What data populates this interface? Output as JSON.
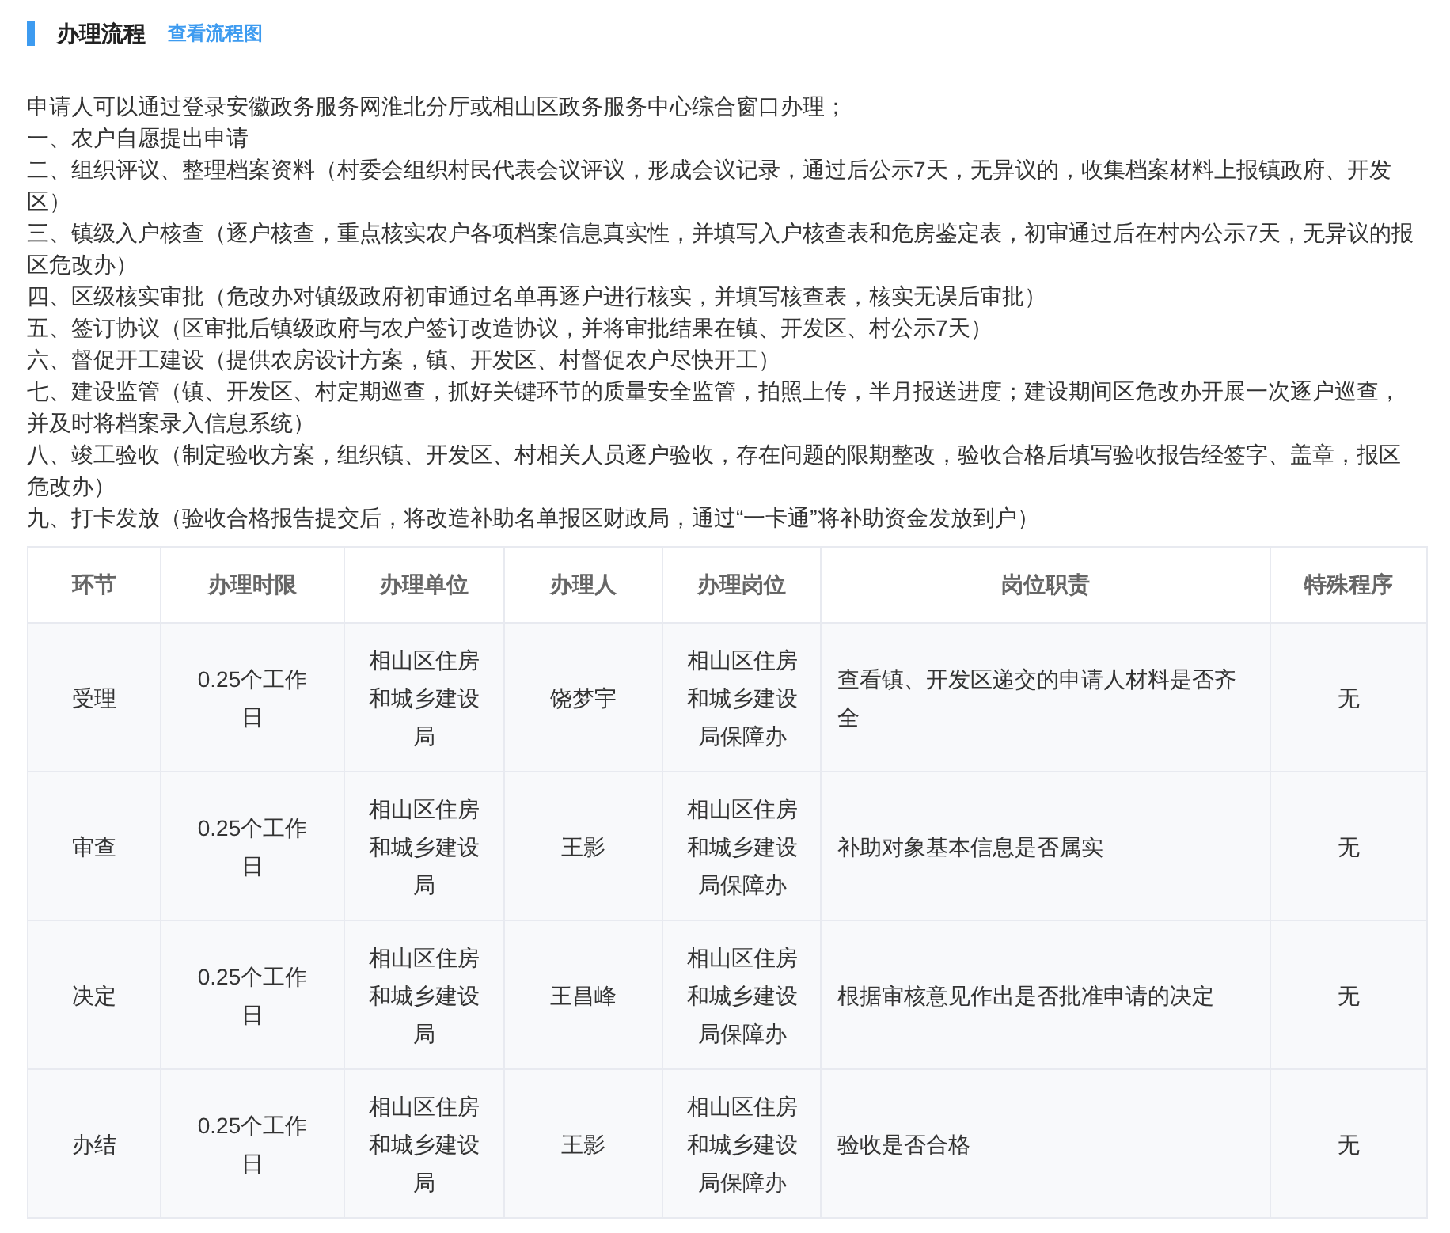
{
  "section": {
    "title": "办理流程",
    "link": "查看流程图"
  },
  "intro": "申请人可以通过登录安徽政务服务网淮北分厅或相山区政务服务中心综合窗口办理；",
  "steps": [
    "一、农户自愿提出申请",
    "二、组织评议、整理档案资料（村委会组织村民代表会议评议，形成会议记录，通过后公示7天，无异议的，收集档案材料上报镇政府、开发区）",
    "三、镇级入户核查（逐户核查，重点核实农户各项档案信息真实性，并填写入户核查表和危房鉴定表，初审通过后在村内公示7天，无异议的报区危改办）",
    "四、区级核实审批（危改办对镇级政府初审通过名单再逐户进行核实，并填写核查表，核实无误后审批）",
    "五、签订协议（区审批后镇级政府与农户签订改造协议，并将审批结果在镇、开发区、村公示7天）",
    "六、督促开工建设（提供农房设计方案，镇、开发区、村督促农户尽快开工）",
    "七、建设监管（镇、开发区、村定期巡查，抓好关键环节的质量安全监管，拍照上传，半月报送进度；建设期间区危改办开展一次逐户巡查，并及时将档案录入信息系统）",
    "八、竣工验收（制定验收方案，组织镇、开发区、村相关人员逐户验收，存在问题的限期整改，验收合格后填写验收报告经签字、盖章，报区危改办）",
    "九、打卡发放（验收合格报告提交后，将改造补助名单报区财政局，通过“一卡通”将补助资金发放到户）"
  ],
  "table": {
    "columns": [
      "环节",
      "办理时限",
      "办理单位",
      "办理人",
      "办理岗位",
      "岗位职责",
      "特殊程序"
    ],
    "rows": [
      [
        "受理",
        "0.25个工作日",
        "相山区住房和城乡建设局",
        "饶梦宇",
        "相山区住房和城乡建设局保障办",
        "查看镇、开发区递交的申请人材料是否齐全",
        "无"
      ],
      [
        "审查",
        "0.25个工作日",
        "相山区住房和城乡建设局",
        "王影",
        "相山区住房和城乡建设局保障办",
        "补助对象基本信息是否属实",
        "无"
      ],
      [
        "决定",
        "0.25个工作日",
        "相山区住房和城乡建设局",
        "王昌峰",
        "相山区住房和城乡建设局保障办",
        "根据审核意见作出是否批准申请的决定",
        "无"
      ],
      [
        "办结",
        "0.25个工作日",
        "相山区住房和城乡建设局",
        "王影",
        "相山区住房和城乡建设局保障办",
        "验收是否合格",
        "无"
      ]
    ]
  }
}
